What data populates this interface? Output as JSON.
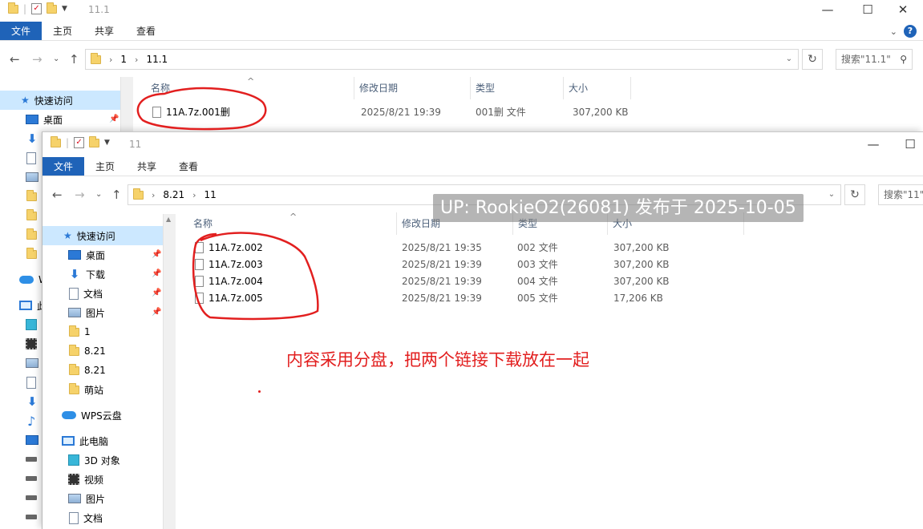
{
  "back_window": {
    "title": "11.1",
    "ribbon_tabs": [
      "文件",
      "主页",
      "共享",
      "查看"
    ],
    "address": [
      "1",
      "11.1"
    ],
    "search_placeholder": "搜索\"11.1\"",
    "nav": {
      "quick_access": "快速访问",
      "desktop": "桌面",
      "wps_partial": "W",
      "pc_partial": "此"
    },
    "columns": [
      "名称",
      "修改日期",
      "类型",
      "大小"
    ],
    "files": [
      {
        "name": "11A.7z.001删",
        "date": "2025/8/21 19:39",
        "type": "001删 文件",
        "size": "307,200 KB"
      }
    ]
  },
  "front_window": {
    "title": "11",
    "ribbon_tabs": [
      "文件",
      "主页",
      "共享",
      "查看"
    ],
    "address": [
      "8.21",
      "11"
    ],
    "search_placeholder": "搜索\"11\"",
    "nav": {
      "quick_access": "快速访问",
      "items": [
        "桌面",
        "下载",
        "文档",
        "图片",
        "1",
        "8.21",
        "8.21",
        "萌站"
      ],
      "wps_cloud": "WPS云盘",
      "this_pc": "此电脑",
      "pc_items": [
        "3D 对象",
        "视频",
        "图片",
        "文档"
      ]
    },
    "columns": [
      "名称",
      "修改日期",
      "类型",
      "大小"
    ],
    "files": [
      {
        "name": "11A.7z.002",
        "date": "2025/8/21 19:35",
        "type": "002 文件",
        "size": "307,200 KB"
      },
      {
        "name": "11A.7z.003",
        "date": "2025/8/21 19:39",
        "type": "003 文件",
        "size": "307,200 KB"
      },
      {
        "name": "11A.7z.004",
        "date": "2025/8/21 19:39",
        "type": "004 文件",
        "size": "307,200 KB"
      },
      {
        "name": "11A.7z.005",
        "date": "2025/8/21 19:39",
        "type": "005 文件",
        "size": "17,206 KB"
      }
    ]
  },
  "overlay": {
    "watermark": "UP: RookieO2(26081) 发布于 2025-10-05",
    "annotation": "内容采用分盘，把两个链接下载放在一起",
    "annotation_color": "#e21f1f"
  },
  "accent_color": "#1f63b8"
}
